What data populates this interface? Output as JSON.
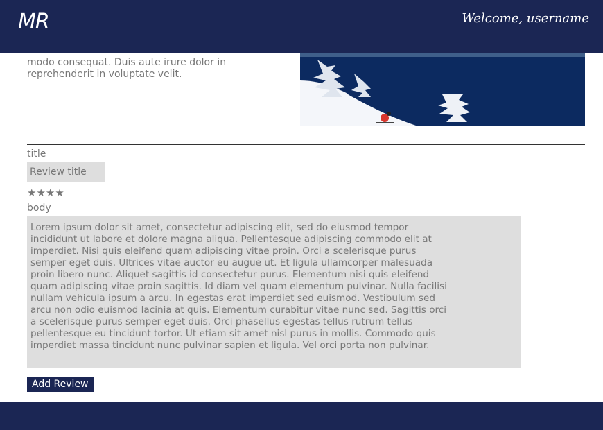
{
  "header": {
    "logo": "MR",
    "welcome": "Welcome, username"
  },
  "intro": {
    "text": "modo consequat. Duis aute irure dolor in reprehenderit in voluptate velit."
  },
  "review_form": {
    "title_label": "title",
    "title_placeholder": "Review title",
    "stars": "★★★★",
    "rating": 4,
    "body_label": "body",
    "body_text": "Lorem ipsum dolor sit amet, consectetur adipiscing elit, sed do eiusmod tempor incididunt ut labore et dolore magna aliqua. Pellentesque adipiscing commodo elit at imperdiet. Nisi quis eleifend quam adipiscing vitae proin. Orci a scelerisque purus semper eget duis. Ultrices vitae auctor eu augue ut. Et ligula ullamcorper malesuada proin libero nunc. Aliquet sagittis id consectetur purus. Elementum nisi quis eleifend quam adipiscing vitae proin sagittis. Id diam vel quam elementum pulvinar. Nulla facilisi nullam vehicula ipsum a arcu. In egestas erat imperdiet sed euismod. Vestibulum sed arcu non odio euismod lacinia at quis. Elementum curabitur vitae nunc sed. Sagittis orci a scelerisque purus semper eget duis. Orci phasellus egestas tellus rutrum tellus pellentesque eu tincidunt tortor. Ut etiam sit amet nisl purus in mollis. Commodo quis imperdiet massa tincidunt nunc pulvinar sapien et ligula. Vel orci porta non pulvinar.",
    "submit_label": "Add Review"
  },
  "colors": {
    "brand_navy": "#1b2654",
    "field_gray": "#dedede",
    "text_gray": "#777777"
  }
}
